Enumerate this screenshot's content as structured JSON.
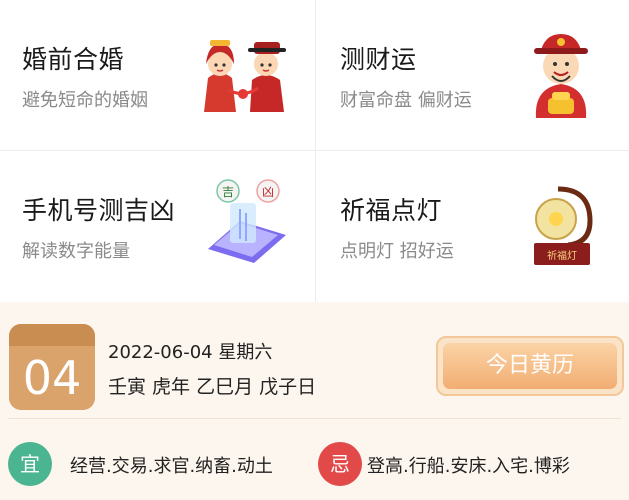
{
  "cards": [
    {
      "title": "婚前合婚",
      "subtitle": "避免短命的婚姻",
      "icon": "wedding-couple-icon"
    },
    {
      "title": "测财运",
      "subtitle": "财富命盘 偏财运",
      "icon": "god-of-wealth-icon"
    },
    {
      "title": "手机号测吉凶",
      "subtitle": "解读数字能量",
      "icon": "phone-fortune-icon",
      "art_labels": [
        "吉",
        "凶"
      ]
    },
    {
      "title": "祈福点灯",
      "subtitle": "点明灯 招好运",
      "icon": "blessing-lamp-icon",
      "art_label": "祈福灯"
    }
  ],
  "almanac": {
    "day": "04",
    "date_line": "2022-06-04 星期六",
    "ganzhi_line": "壬寅 虎年 乙巳月 戊子日",
    "button_label": "今日黄历",
    "yi": {
      "label": "宜",
      "text": "经营.交易.求官.纳畜.动土",
      "color": "#4bb592"
    },
    "ji": {
      "label": "忌",
      "text": "登高.行船.安床.入宅.博彩",
      "color": "#e24a4a"
    }
  }
}
